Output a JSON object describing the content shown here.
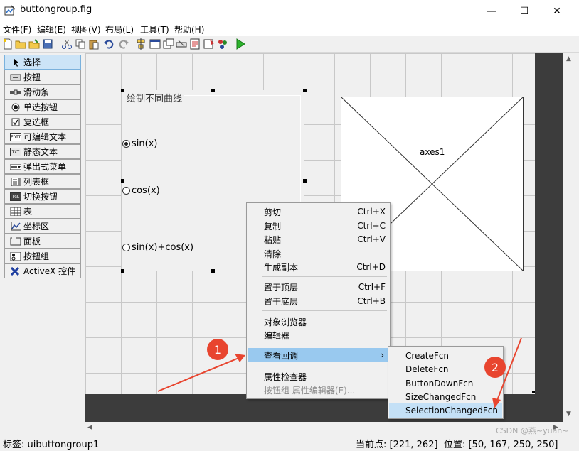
{
  "window": {
    "title": "buttongroup.fig",
    "controls": {
      "minimize": "—",
      "maximize": "☐",
      "close": "✕"
    }
  },
  "menubar": {
    "items": [
      "文件(F)",
      "编辑(E)",
      "视图(V)",
      "布局(L)",
      "工具(T)",
      "帮助(H)"
    ]
  },
  "toolbar": {
    "icons": [
      "new-file-icon",
      "open-folder-icon",
      "open-icon",
      "save-icon",
      "cut-icon",
      "copy-icon",
      "paste-icon",
      "undo-icon",
      "redo-icon",
      "align-icon",
      "menu-editor-icon",
      "tab-order-icon",
      "toolbar-editor-icon",
      "editor-icon",
      "property-inspector-icon",
      "object-browser-icon",
      "run-icon"
    ]
  },
  "palette": {
    "items": [
      {
        "label": "选择",
        "icon": "pointer-icon"
      },
      {
        "label": "按钮",
        "icon": "pushbutton-icon"
      },
      {
        "label": "滑动条",
        "icon": "slider-icon"
      },
      {
        "label": "单选按钮",
        "icon": "radio-icon"
      },
      {
        "label": "复选框",
        "icon": "checkbox-icon"
      },
      {
        "label": "可编辑文本",
        "icon": "edit-text-icon",
        "tag": "EDIT"
      },
      {
        "label": "静态文本",
        "icon": "static-text-icon",
        "tag": "TXT"
      },
      {
        "label": "弹出式菜单",
        "icon": "popup-menu-icon"
      },
      {
        "label": "列表框",
        "icon": "listbox-icon"
      },
      {
        "label": "切换按钮",
        "icon": "toggle-icon",
        "tag": "TGL"
      },
      {
        "label": "表",
        "icon": "table-icon"
      },
      {
        "label": "坐标区",
        "icon": "axes-icon"
      },
      {
        "label": "面板",
        "icon": "panel-icon"
      },
      {
        "label": "按钮组",
        "icon": "button-group-icon"
      },
      {
        "label": "ActiveX 控件",
        "icon": "activex-icon"
      }
    ]
  },
  "buttongroup": {
    "title": "绘制不同曲线",
    "options": [
      {
        "label": "sin(x)",
        "selected": true
      },
      {
        "label": "cos(x)",
        "selected": false
      },
      {
        "label": "sin(x)+cos(x)",
        "selected": false
      }
    ]
  },
  "axes": {
    "label": "axes1"
  },
  "context_menu": {
    "items": [
      {
        "label": "剪切",
        "shortcut": "Ctrl+X"
      },
      {
        "label": "复制",
        "shortcut": "Ctrl+C"
      },
      {
        "label": "粘贴",
        "shortcut": "Ctrl+V"
      },
      {
        "label": "清除",
        "shortcut": ""
      },
      {
        "label": "生成副本",
        "shortcut": "Ctrl+D"
      },
      {
        "label": "置于顶层",
        "shortcut": "Ctrl+F"
      },
      {
        "label": "置于底层",
        "shortcut": "Ctrl+B"
      },
      {
        "label": "对象浏览器",
        "shortcut": ""
      },
      {
        "label": "编辑器",
        "shortcut": ""
      },
      {
        "label": "查看回调",
        "shortcut": ""
      },
      {
        "label": "属性检查器",
        "shortcut": ""
      },
      {
        "label": "按钮组 属性编辑器(E)...",
        "shortcut": "",
        "disabled": true
      }
    ],
    "highlighted_index": 9,
    "submenu_arrow": "›"
  },
  "submenu": {
    "items": [
      "CreateFcn",
      "DeleteFcn",
      "ButtonDownFcn",
      "SizeChangedFcn",
      "SelectionChangedFcn"
    ],
    "highlighted_index": 4
  },
  "annotations": {
    "badge1": "1",
    "badge2": "2",
    "color": "#e8452f"
  },
  "statusbar": {
    "tag": "标签: uibuttongroup1",
    "current_point": "当前点:  [221, 262]",
    "position": "位置: [50, 167, 250, 250]",
    "watermark": "CSDN @燕~yuan~"
  },
  "colors": {
    "canvas": "#f0f0f0",
    "grid": "#c8c8c8",
    "dark_border": "#3c3c3c",
    "highlight": "#99c9ef",
    "selected_tool": "#cce4f7"
  }
}
